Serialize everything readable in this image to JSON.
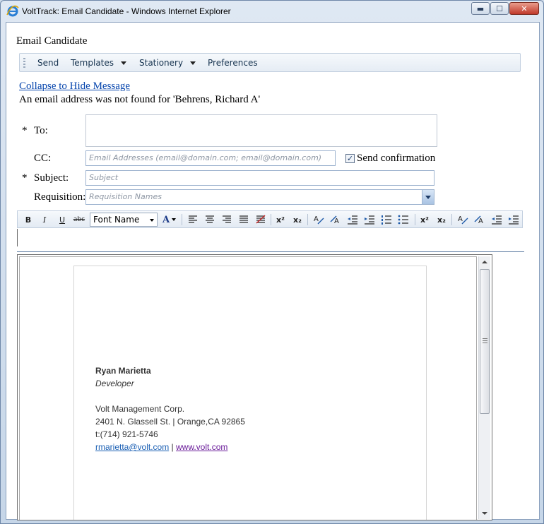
{
  "window": {
    "title": "VoltTrack: Email Candidate - Windows Internet Explorer",
    "minimize_glyph": "▬",
    "maximize_glyph": "☐",
    "close_glyph": "✕"
  },
  "page": {
    "title": "Email Candidate",
    "collapse_link": "Collapse to Hide Message",
    "warning": "An email address was not found for 'Behrens, Richard A'"
  },
  "toolbar": {
    "send": "Send",
    "templates": "Templates",
    "stationery": "Stationery",
    "preferences": "Preferences"
  },
  "form": {
    "required_mark": "*",
    "to_label": "To:",
    "cc_label": "CC:",
    "cc_placeholder": "Email Addresses (email@domain.com; email@domain.com)",
    "send_confirmation_label": "Send confirmation",
    "send_confirmation_checked": true,
    "checkmark": "✓",
    "subject_label": "Subject:",
    "subject_placeholder": "Subject",
    "requisition_label": "Requisition:",
    "requisition_placeholder": "Requisition Names"
  },
  "editor_toolbar": {
    "bold": "B",
    "italic": "I",
    "underline": "U",
    "strike": "abc",
    "font_name": "Font Name",
    "font_color": "A",
    "superscript": "x²",
    "subscript": "x₂"
  },
  "signature": {
    "name": "Ryan Marietta",
    "role": "Developer",
    "company": "Volt Management Corp.",
    "address": "2401 N. Glassell St. | Orange,CA 92865",
    "phone": "t:(714) 921-5746",
    "email": "rmarietta@volt.com",
    "separator": "|",
    "website": "www.volt.com"
  },
  "colors": {
    "link": "#0645ad",
    "accent": "#5f7da3"
  }
}
